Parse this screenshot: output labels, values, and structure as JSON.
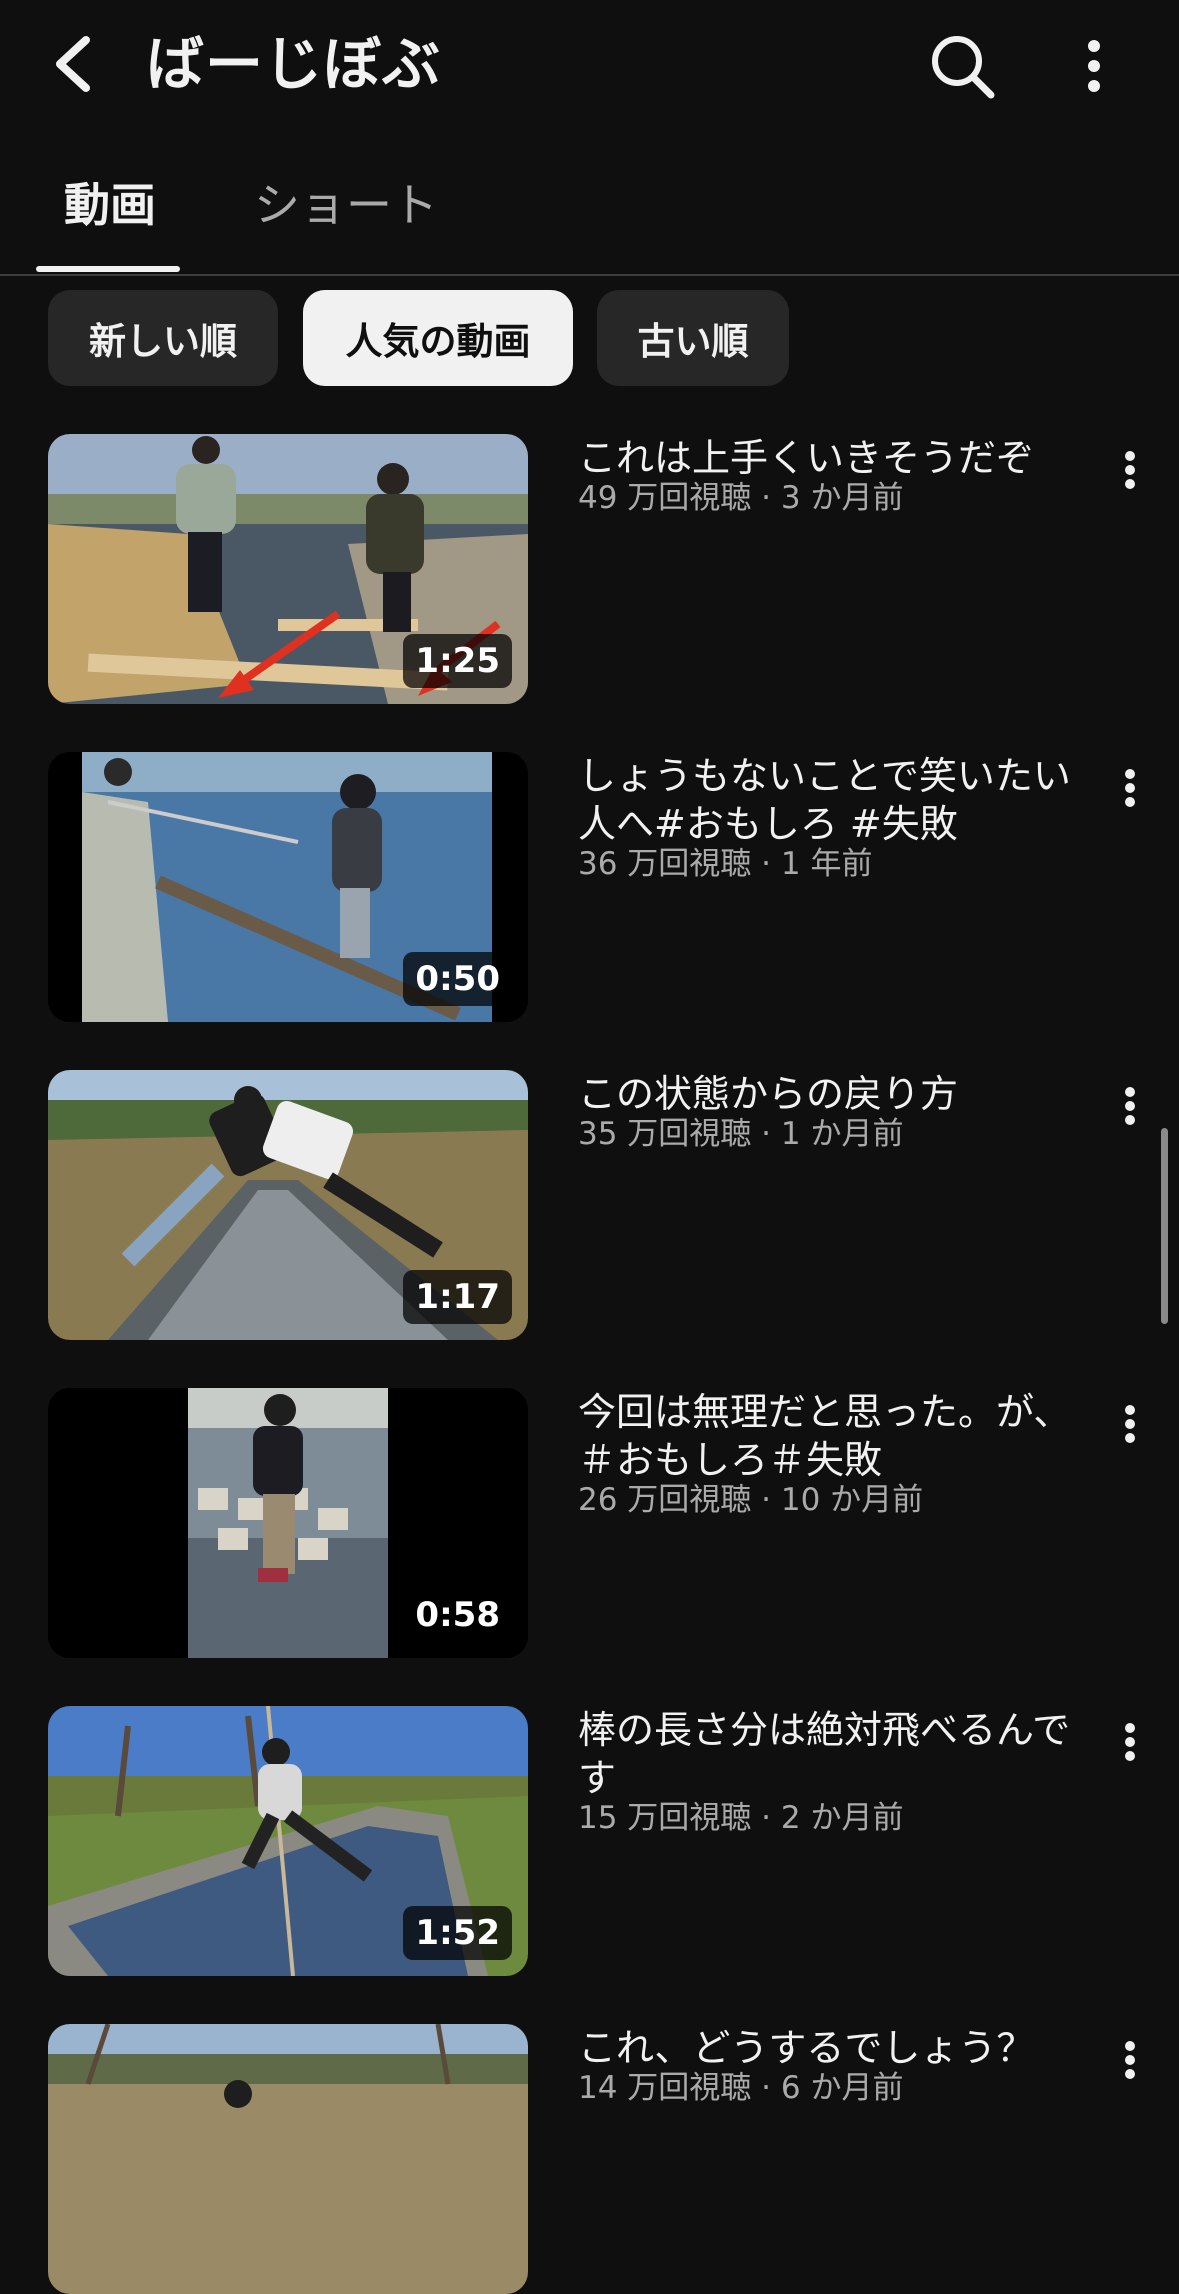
{
  "header": {
    "back_icon": "back-arrow-icon",
    "channel_name": "ばーじぼぶ",
    "search_icon": "search-icon",
    "more_icon": "more-vert-icon"
  },
  "tabs": [
    {
      "label": "動画",
      "active": true
    },
    {
      "label": "ショート",
      "active": false
    }
  ],
  "chips": [
    {
      "label": "新しい順",
      "selected": false
    },
    {
      "label": "人気の動画",
      "selected": true
    },
    {
      "label": "古い順",
      "selected": false
    }
  ],
  "videos": [
    {
      "title": "これは上手くいきそうだぞ",
      "meta": "49 万回視聴 · 3 か月前",
      "duration": "1:25"
    },
    {
      "title": "しょうもないことで笑いたい人へ#おもしろ #失敗",
      "meta": "36 万回視聴 · 1 年前",
      "duration": "0:50"
    },
    {
      "title": "この状態からの戻り方",
      "meta": "35 万回視聴 · 1 か月前",
      "duration": "1:17"
    },
    {
      "title": "今回は無理だと思った。が、＃おもしろ＃失敗",
      "meta": "26 万回視聴 · 10 か月前",
      "duration": "0:58"
    },
    {
      "title": "棒の長さ分は絶対飛べるんです",
      "meta": "15 万回視聴 · 2 か月前",
      "duration": "1:52"
    },
    {
      "title": "これ、どうするでしょう？",
      "meta": "14 万回視聴 · 6 か月前",
      "duration": ""
    }
  ],
  "colors": {
    "background": "#0f0f0f",
    "chip_bg": "#272727",
    "chip_selected_bg": "#f1f1f1",
    "text_primary": "#f1f1f1",
    "text_secondary": "#aaaaaa"
  }
}
